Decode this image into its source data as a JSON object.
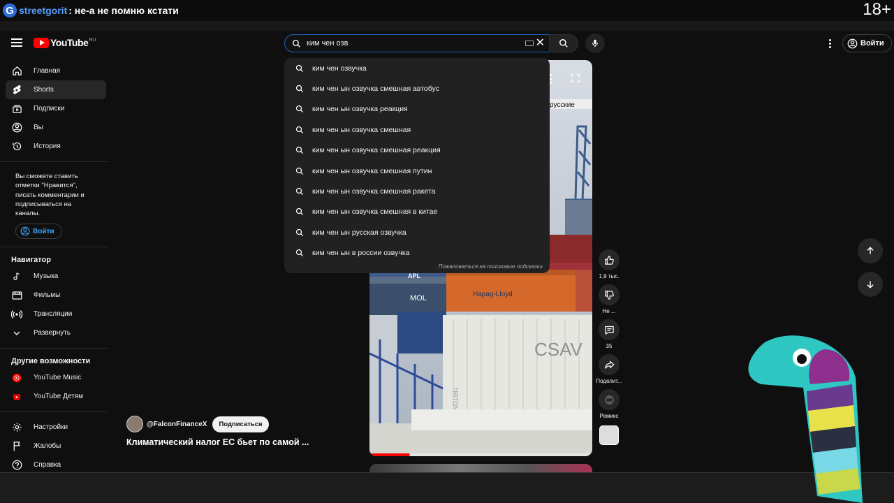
{
  "stream": {
    "logo_letter": "G",
    "username": "streetgorit",
    "message": ": не-а не помню кстати",
    "age_badge": "18+"
  },
  "header": {
    "logo_text": "YouTube",
    "logo_region": "RU",
    "search_value": "ким чен озв",
    "signin_label": "Войти"
  },
  "suggestions": {
    "items": [
      "ким чен озвучка",
      "ким чен ын озвучка смешная автобус",
      "ким чен ын озвучка реакция",
      "ким чен ын озвучка смешная",
      "ким чен ын озвучка смешная реакция",
      "ким чен ын озвучка смешная путин",
      "ким чен ын озвучка смешная ракета",
      "ким чен ын озвучка смешная в китае",
      "ким чен ын русская озвучка",
      "ким чен ын в россии озвучка"
    ],
    "report_label": "Пожаловаться на поисковые подсказки"
  },
  "sidebar": {
    "main": [
      {
        "label": "Главная",
        "icon": "home-icon"
      },
      {
        "label": "Shorts",
        "icon": "shorts-icon"
      },
      {
        "label": "Подписки",
        "icon": "subscriptions-icon"
      },
      {
        "label": "Вы",
        "icon": "you-icon"
      },
      {
        "label": "История",
        "icon": "history-icon"
      }
    ],
    "signin_note": "Вы сможете ставить отметки \"Нравится\", писать комментарии и подписываться на каналы.",
    "signin_label": "Войти",
    "navigator_title": "Навигатор",
    "navigator": [
      {
        "label": "Музыка",
        "icon": "music-icon"
      },
      {
        "label": "Фильмы",
        "icon": "movies-icon"
      },
      {
        "label": "Трансляции",
        "icon": "live-icon"
      },
      {
        "label": "Развернуть",
        "icon": "chevron-down-icon"
      }
    ],
    "other_title": "Другие возможности",
    "other": [
      {
        "label": "YouTube Music",
        "icon": "youtube-music-icon"
      },
      {
        "label": "YouTube Детям",
        "icon": "youtube-kids-icon"
      }
    ],
    "footer": [
      {
        "label": "Настройки",
        "icon": "settings-icon"
      },
      {
        "label": "Жалобы",
        "icon": "flag-icon"
      },
      {
        "label": "Справка",
        "icon": "help-icon"
      }
    ]
  },
  "video": {
    "channel": "@FalconFinanceX",
    "subscribe_label": "Подписаться",
    "title": "Климатический налог ЕС бьет по самой ...",
    "caption_fragment": "русские",
    "container_labels": {
      "hapag": "Hapag-Lloyd",
      "csav": "CSAV",
      "mol": "MOL",
      "apl": "APL",
      "triton": "TRITON"
    },
    "progress_fraction": 0.18
  },
  "actions": {
    "like_count": "1,9 тыс.",
    "dislike_label": "Не ...",
    "comments_count": "35",
    "share_label": "Поделит...",
    "remix_label": "Ремикс"
  },
  "colors": {
    "accent_blue": "#3ea6ff",
    "brand_red": "#ff0000",
    "bg": "#0f0f0f"
  }
}
